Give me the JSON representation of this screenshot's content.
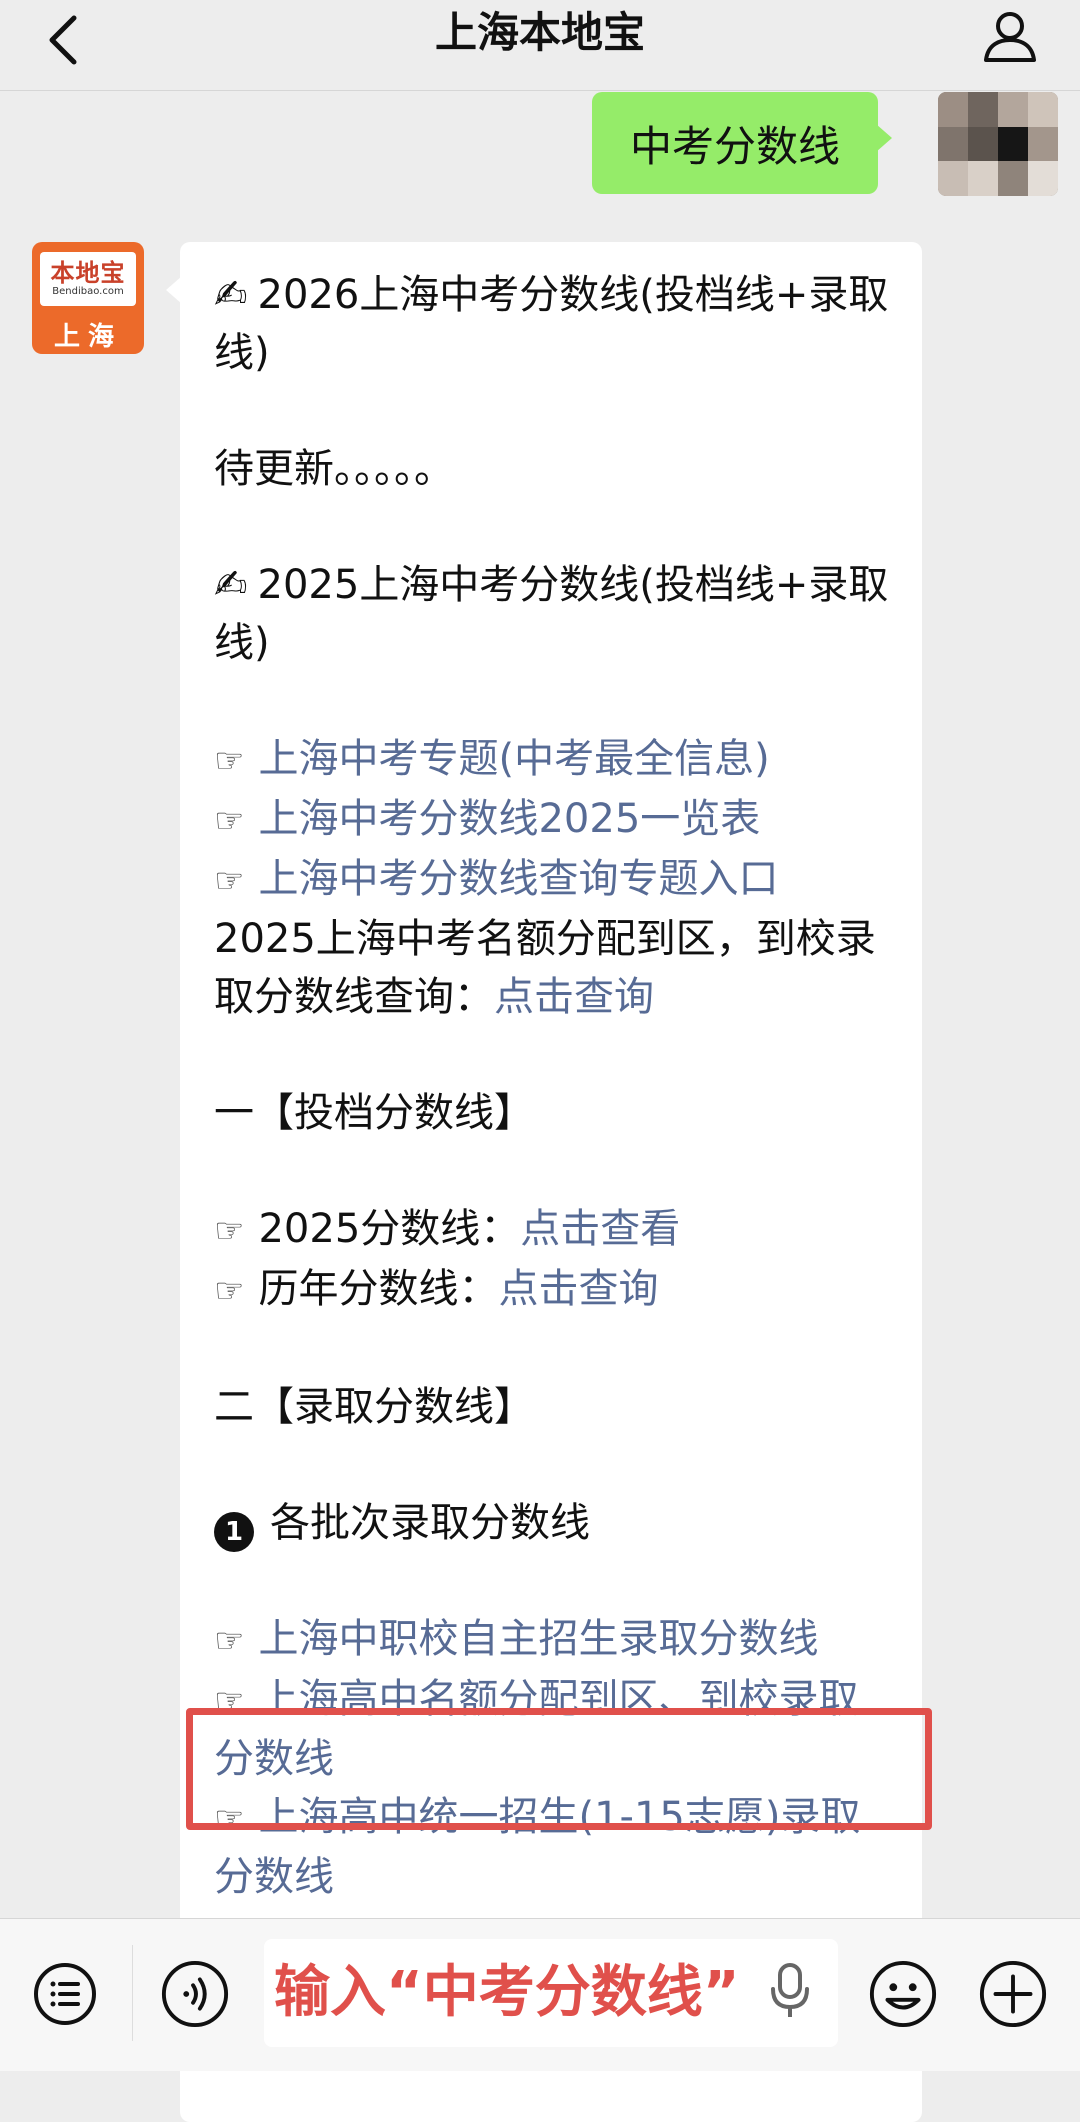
{
  "header": {
    "title": "上海本地宝",
    "back_icon": "chevron-left-icon",
    "profile_icon": "user-icon"
  },
  "outgoing": {
    "text": "中考分数线"
  },
  "incoming": {
    "avatar": {
      "brand": "本地宝",
      "url": "Bendibao.com",
      "city": "上海"
    },
    "lines": {
      "l1": "2026上海中考分数线(投档线+录取线)",
      "l2": "待更新。。。。。",
      "l3": "2025上海中考分数线(投档线+录取线)",
      "link1": "上海中考专题(中考最全信息)",
      "link2": "上海中考分数线2025一览表",
      "link3": "上海中考分数线查询专题入口",
      "l4": "2025上海中考名额分配到区，到校录取分数线查询：",
      "l4_link": "点击查询",
      "sec1": "一【投档分数线】",
      "s1a_label": "2025分数线：",
      "s1a_link": "点击查看",
      "s1b_label": "历年分数线：",
      "s1b_link": "点击查询",
      "sec2": "二【录取分数线】",
      "item1_num": "1",
      "item1": "各批次录取分数线",
      "link4": "上海中职校自主招生录取分数线",
      "link5": "上海高中名额分配到区、到校录取分数线",
      "link6": "上海高中统一招生(1-15志愿)录取分数线"
    }
  },
  "bottom": {
    "input_text": "输入“中考分数线”",
    "icons": [
      "menu-list-icon",
      "voice-icon",
      "emoji-icon",
      "plus-icon",
      "mic-icon"
    ]
  },
  "colors": {
    "link": "#576b95",
    "outgoing_bubble": "#95ec69",
    "highlight": "#e0504b",
    "background": "#ededed"
  }
}
